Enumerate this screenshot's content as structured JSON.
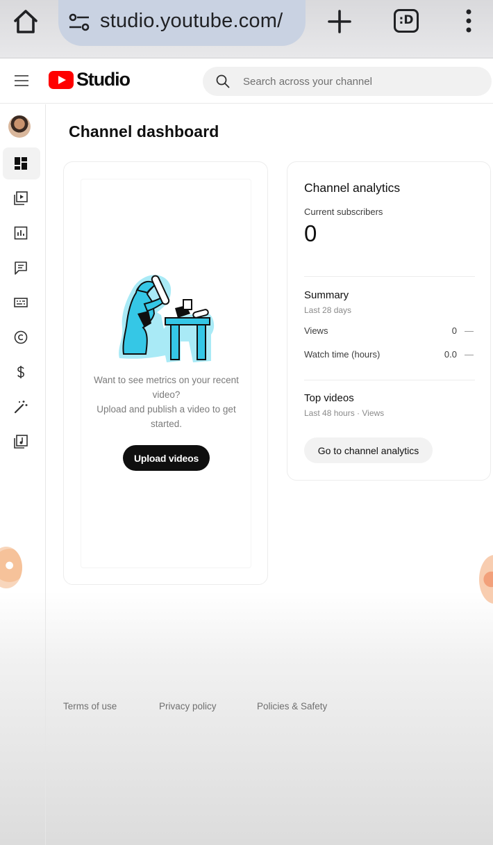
{
  "browser": {
    "url": "studio.youtube.com/",
    "tabs_label": ":D"
  },
  "header": {
    "logo_text": "Studio",
    "search_placeholder": "Search across your channel"
  },
  "page": {
    "title": "Channel dashboard"
  },
  "upload_card": {
    "message_line1": "Want to see metrics on your recent video?",
    "message_line2": "Upload and publish a video to get started.",
    "button_label": "Upload videos"
  },
  "analytics": {
    "title": "Channel analytics",
    "subscribers_label": "Current subscribers",
    "subscribers_count": "0",
    "summary_title": "Summary",
    "summary_period": "Last 28 days",
    "metrics": [
      {
        "label": "Views",
        "value": "0",
        "trend": "—"
      },
      {
        "label": "Watch time (hours)",
        "value": "0.0",
        "trend": "—"
      }
    ],
    "top_videos_title": "Top videos",
    "top_videos_period": "Last 48 hours · Views",
    "button_label": "Go to channel analytics"
  },
  "footer": {
    "links": [
      "Terms of use",
      "Privacy policy",
      "Policies & Safety"
    ]
  },
  "sidebar": {
    "items": [
      "dashboard",
      "content",
      "analytics",
      "comments",
      "subtitles",
      "copyright",
      "earn",
      "customization",
      "audio-library"
    ],
    "active": "dashboard"
  },
  "colors": {
    "brand_red": "#ff0000",
    "illustration_cyan": "#35c7e6",
    "primary_button": "#0f0f0f"
  }
}
